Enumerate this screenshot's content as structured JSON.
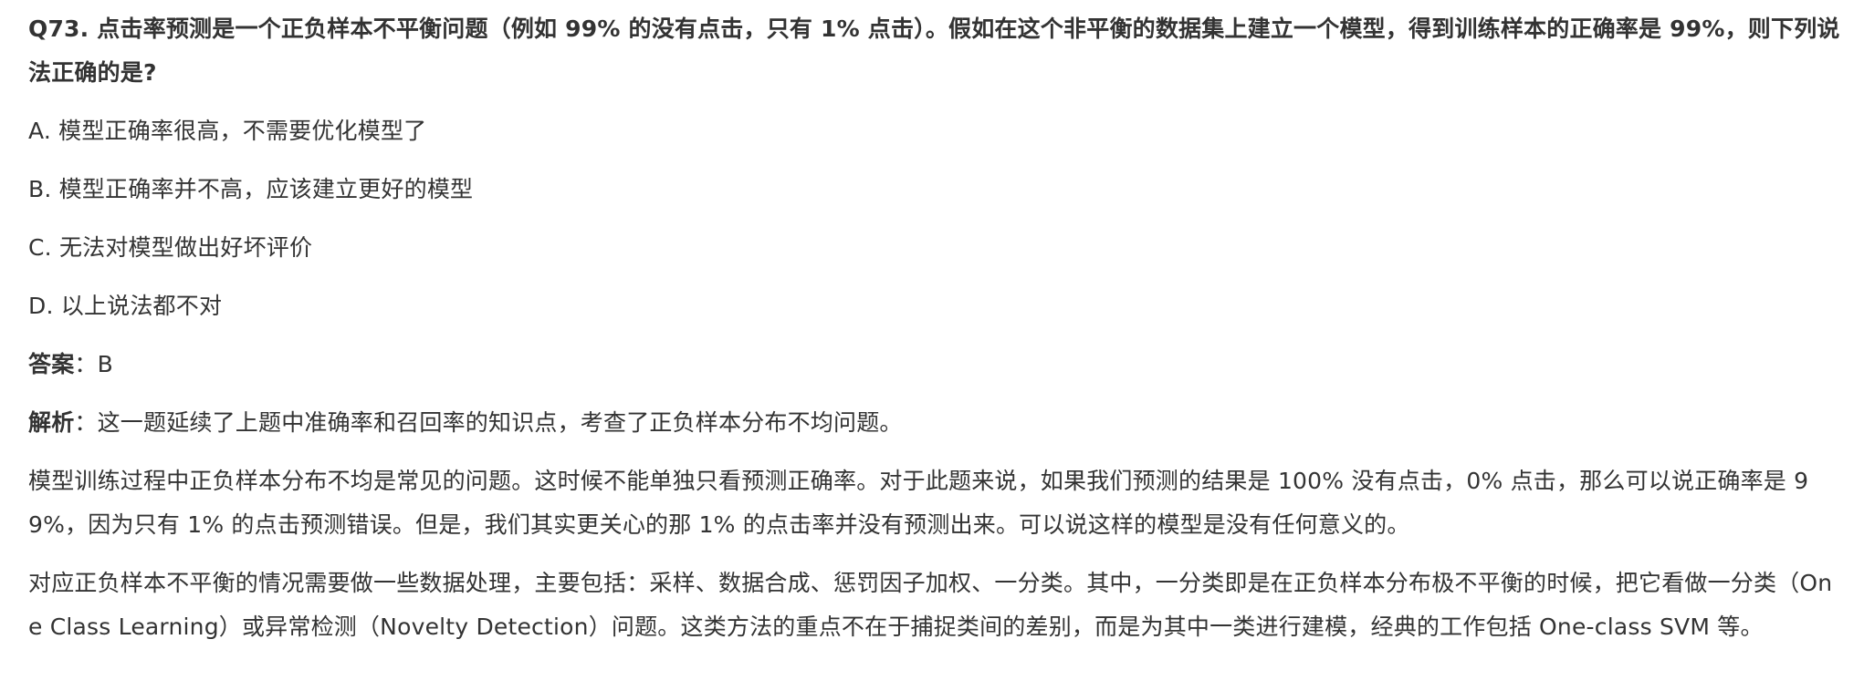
{
  "question": "Q73. 点击率预测是一个正负样本不平衡问题（例如 99% 的没有点击，只有 1% 点击）。假如在这个非平衡的数据集上建立一个模型，得到训练样本的正确率是 99%，则下列说法正确的是?",
  "options": [
    "A. 模型正确率很高，不需要优化模型了",
    "B. 模型正确率并不高，应该建立更好的模型",
    "C. 无法对模型做出好坏评价",
    "D. 以上说法都不对"
  ],
  "answer": {
    "label": "答案",
    "separator": "：",
    "value": "B"
  },
  "analysis": {
    "label": "解析",
    "separator": "：",
    "text": "这一题延续了上题中准确率和召回率的知识点，考查了正负样本分布不均问题。"
  },
  "paragraphs": [
    "模型训练过程中正负样本分布不均是常见的问题。这时候不能单独只看预测正确率。对于此题来说，如果我们预测的结果是 100% 没有点击，0% 点击，那么可以说正确率是 99%，因为只有 1% 的点击预测错误。但是，我们其实更关心的那 1% 的点击率并没有预测出来。可以说这样的模型是没有任何意义的。",
    "对应正负样本不平衡的情况需要做一些数据处理，主要包括：采样、数据合成、惩罚因子加权、一分类。其中，一分类即是在正负样本分布极不平衡的时候，把它看做一分类（One Class Learning）或异常检测（Novelty Detection）问题。这类方法的重点不在于捕捉类间的差别，而是为其中一类进行建模，经典的工作包括 One-class SVM 等。"
  ]
}
